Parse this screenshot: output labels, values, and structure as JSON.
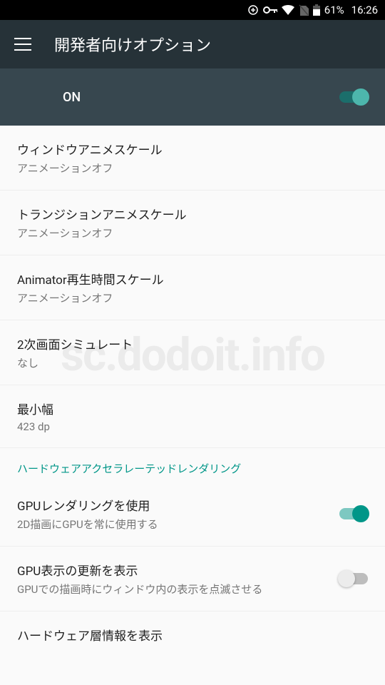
{
  "statusBar": {
    "batteryPercent": "61%",
    "time": "16:26"
  },
  "appBar": {
    "title": "開発者向けオプション"
  },
  "master": {
    "label": "ON",
    "on": true
  },
  "sectionHeader": "ハードウェアアクセラレーテッドレンダリング",
  "settings": [
    {
      "title": "ウィンドウアニメスケール",
      "subtitle": "アニメーションオフ"
    },
    {
      "title": "トランジションアニメスケール",
      "subtitle": "アニメーションオフ"
    },
    {
      "title": "Animator再生時間スケール",
      "subtitle": "アニメーションオフ"
    },
    {
      "title": "2次画面シミュレート",
      "subtitle": "なし"
    },
    {
      "title": "最小幅",
      "subtitle": "423 dp"
    }
  ],
  "gpuSettings": [
    {
      "title": "GPUレンダリングを使用",
      "subtitle": "2D描画にGPUを常に使用する",
      "switch": "on"
    },
    {
      "title": "GPU表示の更新を表示",
      "subtitle": "GPUでの描画時にウィンドウ内の表示を点滅させる",
      "switch": "off"
    },
    {
      "title": "ハードウェア層情報を表示",
      "subtitle": ""
    }
  ],
  "watermark": "sc.dodoit.info"
}
